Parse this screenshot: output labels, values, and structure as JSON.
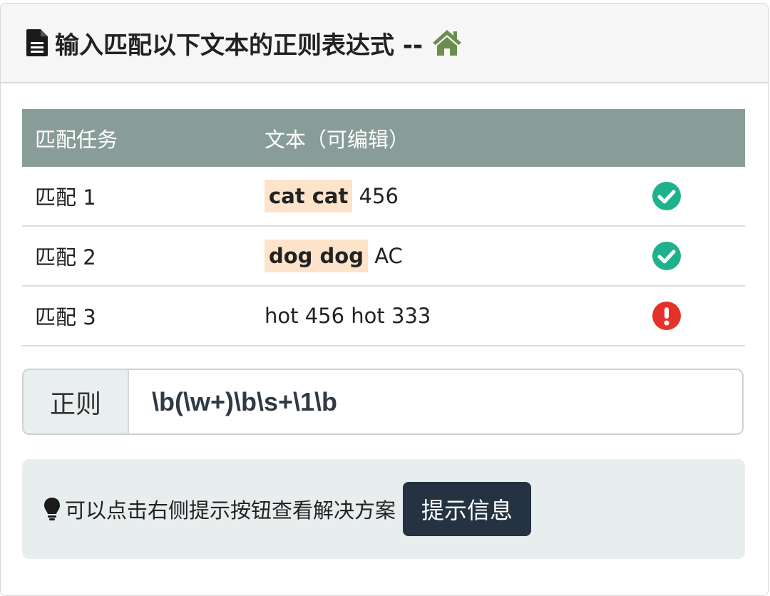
{
  "header": {
    "title": "输入匹配以下文本的正则表达式 --",
    "doc_icon": "document-icon",
    "home_icon": "home-icon",
    "home_icon_color": "#6b8e4e"
  },
  "table": {
    "columns": [
      "匹配任务",
      "文本（可编辑）",
      ""
    ],
    "header_bg": "#889c98",
    "rows": [
      {
        "task": "匹配 1",
        "match": "cat cat",
        "rest": " 456",
        "status": "check-circle-icon"
      },
      {
        "task": "匹配 2",
        "match": "dog dog",
        "rest": " AC",
        "status": "check-circle-icon"
      },
      {
        "task": "匹配 3",
        "match": "",
        "rest": "hot 456 hot 333",
        "status": "exclamation-circle-icon"
      }
    ],
    "status_colors": {
      "success": "#1fb18c",
      "error": "#e4322b"
    }
  },
  "regex": {
    "label": "正则",
    "value": "\\b(\\w+)\\b\\s+\\1\\b"
  },
  "hint": {
    "icon": "lightbulb-icon",
    "text": "可以点击右侧提示按钮查看解决方案",
    "button_label": "提示信息"
  }
}
